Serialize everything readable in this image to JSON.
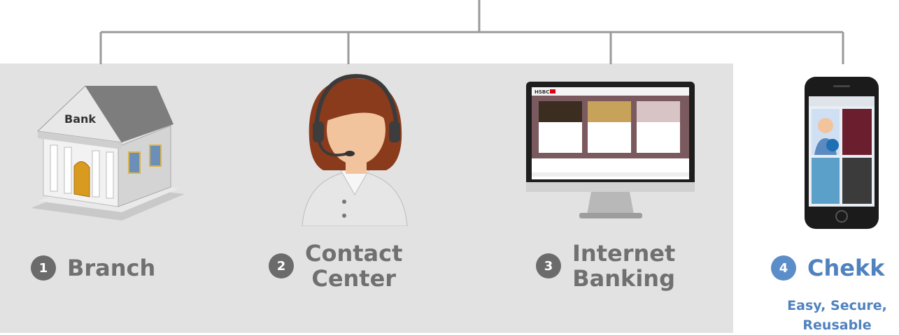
{
  "channels": [
    {
      "number": "1",
      "label": "Branch",
      "icon": "bank-building-icon"
    },
    {
      "number": "2",
      "label_line1": "Contact",
      "label_line2": "Center",
      "icon": "call-center-agent-icon"
    },
    {
      "number": "3",
      "label_line1": "Internet",
      "label_line2": "Banking",
      "icon": "desktop-monitor-icon"
    },
    {
      "number": "4",
      "label": "Chekk",
      "icon": "smartphone-icon"
    }
  ],
  "bank_sign": "Bank",
  "website_logo": "HSBC",
  "tagline_line1": "Easy, Secure,",
  "tagline_line2": "Reusable",
  "colors": {
    "panel": "#e2e2e2",
    "badge_gray": "#6b6b6b",
    "label_gray": "#707070",
    "accent_blue": "#4f82bf",
    "connector": "#9a9a9a"
  }
}
